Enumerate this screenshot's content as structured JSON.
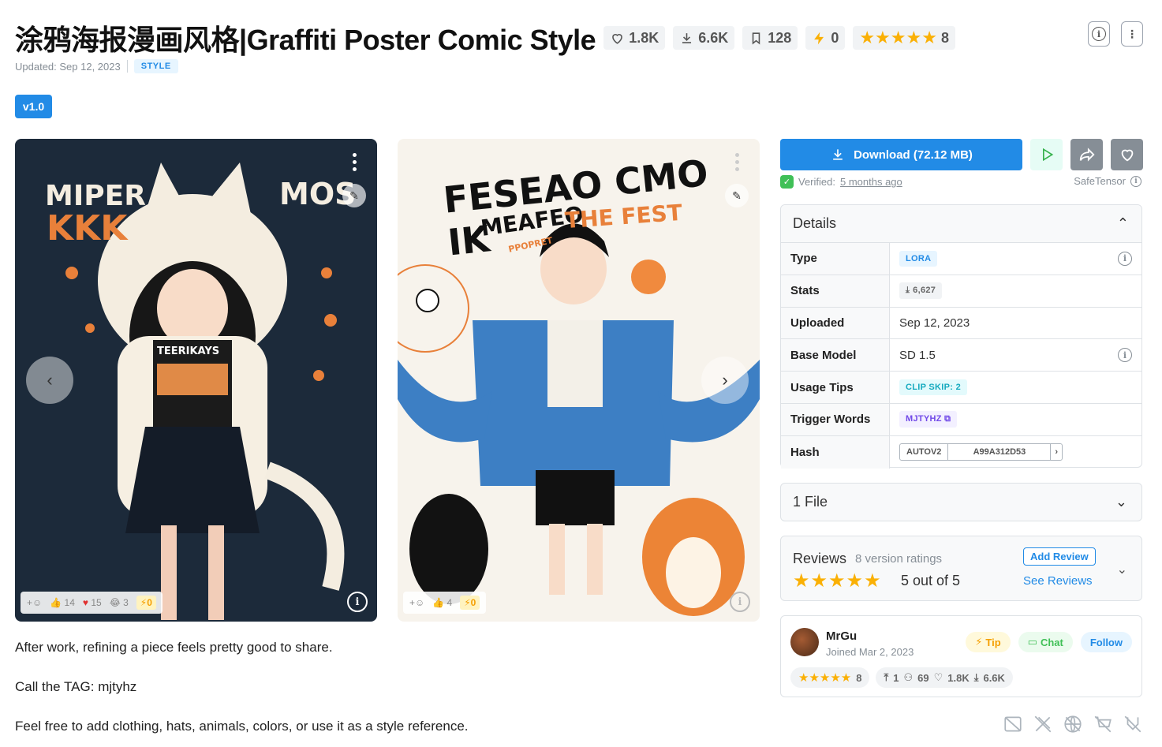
{
  "header": {
    "title": "涂鸦海报漫画风格|Graffiti Poster Comic Style",
    "likes": "1.8K",
    "downloads": "6.6K",
    "bookmarks": "128",
    "tips": "0",
    "rating_count": "8",
    "updated": "Updated: Sep 12, 2023",
    "category": "STYLE",
    "version": "v1.0"
  },
  "gallery": {
    "card1": {
      "art_line1": "MIPER",
      "art_line2": "KKK",
      "art_line3": "MOS",
      "shirt_text": "TEERIKAYS",
      "reactions": {
        "thumbs": "14",
        "hearts": "15",
        "laugh": "3",
        "bolt": "0"
      }
    },
    "card2": {
      "art_line1": "FESEAO CMO IK",
      "art_line2": "MEAFEO",
      "art_line3": "THE FEST",
      "art_line4": "PPOPRET",
      "reactions": {
        "thumbs": "4",
        "bolt": "0"
      }
    }
  },
  "description": {
    "p1": "After work, refining a piece feels pretty good to share.",
    "p2": "Call the TAG: mjtyhz",
    "p3": "Feel free to add clothing, hats, animals, colors, or use it as a style reference."
  },
  "download": {
    "label": "Download (72.12 MB)",
    "verified_label": "Verified:",
    "verified_time": "5 months ago",
    "format": "SafeTensor"
  },
  "details": {
    "title": "Details",
    "rows": [
      {
        "key": "Type",
        "value": "LORA"
      },
      {
        "key": "Stats",
        "value": "6,627"
      },
      {
        "key": "Uploaded",
        "value": "Sep 12, 2023"
      },
      {
        "key": "Base Model",
        "value": "SD 1.5"
      },
      {
        "key": "Usage Tips",
        "value": "CLIP SKIP: 2"
      },
      {
        "key": "Trigger Words",
        "value": "MJTYHZ"
      },
      {
        "key": "Hash",
        "value": "AUTOV2",
        "hash": "A99A312D53"
      }
    ]
  },
  "files": {
    "label": "1 File"
  },
  "reviews": {
    "title": "Reviews",
    "subtitle": "8 version ratings",
    "score": "5 out of 5",
    "add_label": "Add Review",
    "see_label": "See Reviews"
  },
  "creator": {
    "name": "MrGu",
    "joined": "Joined Mar 2, 2023",
    "tip_label": "Tip",
    "chat_label": "Chat",
    "follow_label": "Follow",
    "rating_count": "8",
    "uploads": "1",
    "followers": "69",
    "likes": "1.8K",
    "downloads": "6.6K"
  },
  "colors": {
    "accent": "#228be6",
    "star": "#fab005",
    "verified": "#40c057"
  }
}
